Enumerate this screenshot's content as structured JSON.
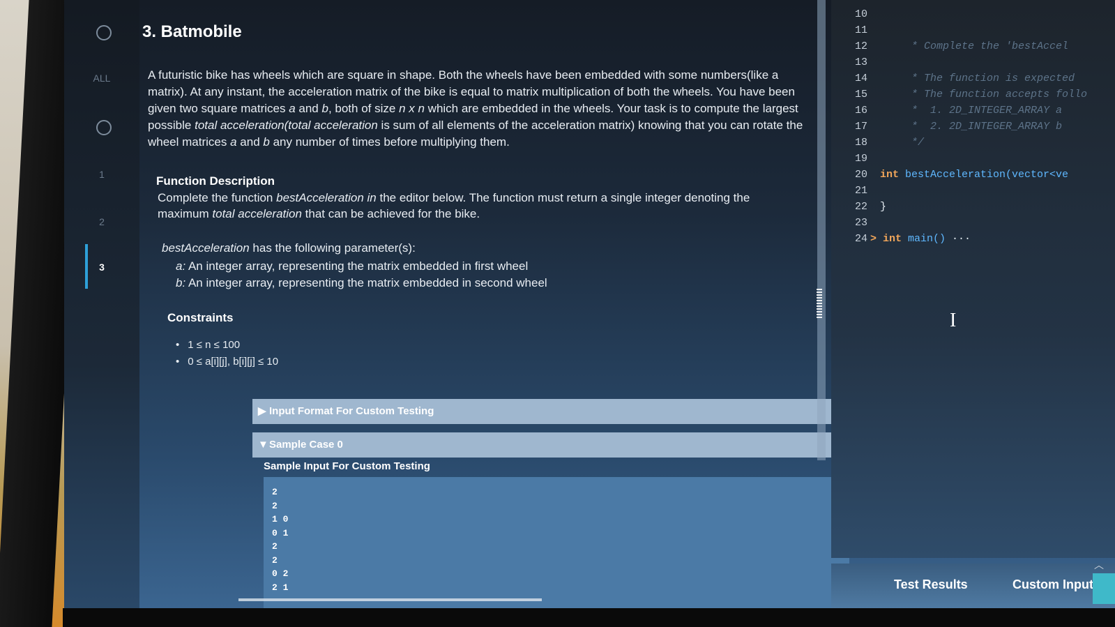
{
  "rail": {
    "all_label": "ALL",
    "items": [
      "1",
      "2",
      "3"
    ],
    "active_item": "3"
  },
  "problem": {
    "title": "3. Batmobile",
    "description": {
      "p1": "A futuristic bike has wheels which are square in shape. Both the wheels have been embedded with some numbers(like a matrix). At any instant, the acceleration matrix of the bike is equal to matrix multiplication of both the wheels. You have been given two square matrices ",
      "a": "a",
      "and": " and ",
      "b": "b",
      "p2": ", both of size ",
      "nxn": "n x n",
      "p3": " which are embedded in the wheels. Your task is to compute the largest possible ",
      "total_acc": "total acceleration(total acceleration",
      "p4": " is sum of all elements of the acceleration matrix) knowing that you can rotate the wheel matrices ",
      "a2": "a",
      "and2": " and ",
      "b2": "b",
      "p5": " any number of times before multiplying them."
    },
    "function_description": {
      "title": "Function Description",
      "t1": "Complete the function ",
      "fn": "bestAcceleration in",
      "t2": " the editor below. The function must return a single integer denoting the maximum ",
      "t3": "total acceleration",
      "t4": " that can be achieved for the bike."
    },
    "params": {
      "title_fn": "bestAcceleration",
      "title_rest": " has the following parameter(s):",
      "a_name": "a:",
      "a_text": " An integer array, representing the matrix embedded in first wheel",
      "b_name": "b:",
      "b_text": " An integer array, representing the matrix embedded in second wheel"
    },
    "constraints": {
      "title": "Constraints",
      "items": [
        "1 ≤ n ≤ 100",
        "0 ≤ a[i][j], b[i][j] ≤ 10"
      ]
    },
    "input_format_label": "Input Format For Custom Testing",
    "sample_case_label": "Sample Case 0",
    "sample_input_label": "Sample Input For Custom Testing",
    "sample_input_lines": [
      "2",
      "2",
      "1 0",
      "0 1",
      "2",
      "2",
      "0 2",
      "2 1"
    ]
  },
  "editor": {
    "lines": [
      {
        "n": "10",
        "html": ""
      },
      {
        "n": "11",
        "html": ""
      },
      {
        "n": "12",
        "html": "     * Complete the 'bestAccel"
      },
      {
        "n": "13",
        "html": ""
      },
      {
        "n": "14",
        "html": "     * The function is expected"
      },
      {
        "n": "15",
        "html": "     * The function accepts follo"
      },
      {
        "n": "16",
        "html": "     *  1. 2D_INTEGER_ARRAY a"
      },
      {
        "n": "17",
        "html": "     *  2. 2D_INTEGER_ARRAY b"
      },
      {
        "n": "18",
        "html": "     */"
      },
      {
        "n": "19",
        "html": ""
      },
      {
        "n": "20",
        "kw": "int",
        "fn": " bestAcceleration(vector<ve"
      },
      {
        "n": "21",
        "html": ""
      },
      {
        "n": "22",
        "plain": "}"
      },
      {
        "n": "23",
        "html": ""
      },
      {
        "n": "24",
        "kw": "> int",
        "fn": " main()",
        "plain": " ···"
      }
    ]
  },
  "tabs": {
    "test_results": "Test Results",
    "custom_input": "Custom Input"
  },
  "icons": {
    "collapse": "chevron-up-icon"
  }
}
